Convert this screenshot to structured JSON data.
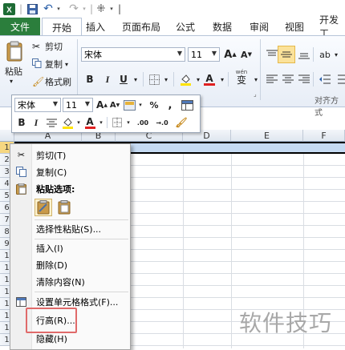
{
  "qat": {
    "undo": "↶",
    "redo": "↷",
    "brush": "⁜"
  },
  "tabs": {
    "file": "文件",
    "items": [
      "开始",
      "插入",
      "页面布局",
      "公式",
      "数据",
      "审阅",
      "视图",
      "开发工"
    ]
  },
  "ribbon": {
    "paste_label": "粘贴",
    "cut_label": "剪切",
    "copy_label": "复制",
    "format_painter_label": "格式刷",
    "font_name": "宋体",
    "font_size": "11",
    "grow_font": "A",
    "shrink_font": "A",
    "bold": "B",
    "italic": "I",
    "underline": "U",
    "wen_label": "wén",
    "align_group_label": "对齐方式",
    "wen_glyph": "变"
  },
  "mini_toolbar": {
    "font_name": "宋体",
    "font_size": "11",
    "grow": "A",
    "shrink": "A",
    "percent": "%",
    "comma": ",",
    "bold": "B",
    "italic": "I",
    "increase_decimal": ".00",
    "decrease_decimal": "→.0"
  },
  "grid": {
    "columns": [
      "A",
      "B",
      "C",
      "D",
      "E",
      "F"
    ],
    "rows": [
      "1",
      "2",
      "3",
      "4",
      "5",
      "6",
      "7",
      "8",
      "9",
      "1",
      "1",
      "1",
      "1",
      "1",
      "1",
      "1",
      "1"
    ]
  },
  "context_menu": {
    "items": [
      {
        "label": "剪切(T)",
        "icon": "scissors-icon"
      },
      {
        "label": "复制(C)",
        "icon": "copy-icon"
      },
      {
        "label": "粘贴选项:",
        "icon": "paste-icon",
        "bold": true
      },
      {
        "label": "选择性粘贴(S)...",
        "icon": ""
      },
      {
        "label": "插入(I)",
        "icon": ""
      },
      {
        "label": "删除(D)",
        "icon": ""
      },
      {
        "label": "清除内容(N)",
        "icon": ""
      },
      {
        "label": "设置单元格格式(F)...",
        "icon": "format-cells-icon"
      },
      {
        "label": "行高(R)...",
        "icon": ""
      },
      {
        "label": "隐藏(H)",
        "icon": ""
      }
    ]
  },
  "watermark": "软件技巧",
  "colors": {
    "file_tab": "#2b7e3c",
    "highlight": "#e06a6a",
    "selected_row": "#c5daf2"
  }
}
